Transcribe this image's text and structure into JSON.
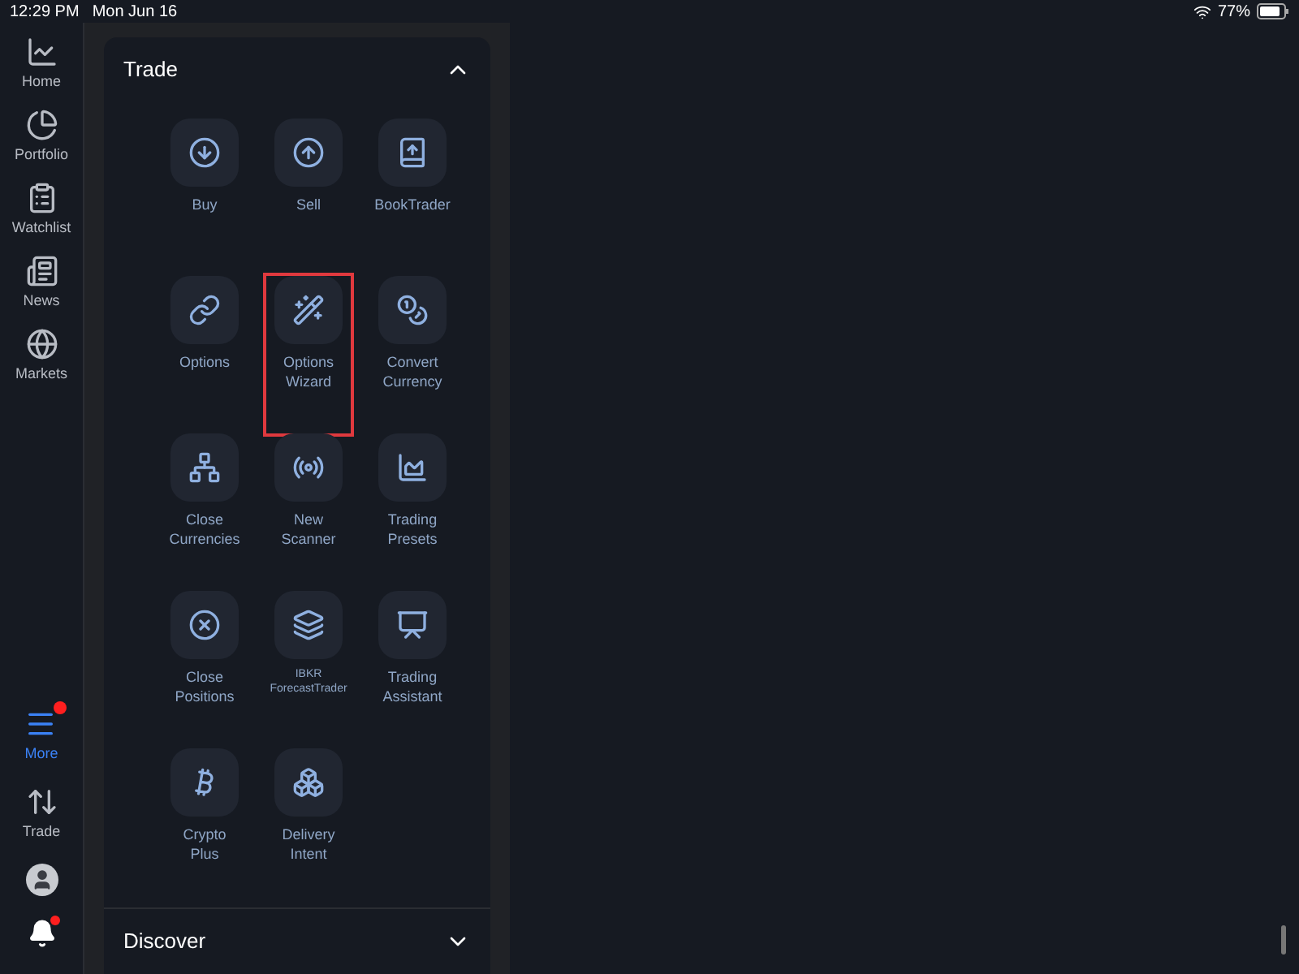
{
  "status_bar": {
    "time": "12:29 PM",
    "date": "Mon Jun 16",
    "battery": "77%"
  },
  "sidebar": {
    "items": [
      {
        "label": "Home",
        "selected": false,
        "has_alert": false
      },
      {
        "label": "Portfolio",
        "selected": false,
        "has_alert": false
      },
      {
        "label": "Watchlist",
        "selected": false,
        "has_alert": false
      },
      {
        "label": "News",
        "selected": false,
        "has_alert": false
      },
      {
        "label": "Markets",
        "selected": false,
        "has_alert": false
      }
    ],
    "bottom_items": [
      {
        "label": "More",
        "selected": true,
        "has_alert": true
      },
      {
        "label": "Trade",
        "selected": false,
        "has_alert": false
      }
    ],
    "notifications": {
      "has_alert": true
    }
  },
  "sections": [
    {
      "title": "Trade",
      "expanded": true,
      "items": [
        {
          "label": "Buy",
          "highlighted": false
        },
        {
          "label": "Sell",
          "highlighted": false
        },
        {
          "label": "BookTrader",
          "highlighted": false
        },
        {
          "label": "Options",
          "highlighted": false
        },
        {
          "label": "Options\nWizard",
          "highlighted": true
        },
        {
          "label": "Convert\nCurrency",
          "highlighted": false
        },
        {
          "label": "Close\nCurrencies",
          "highlighted": false
        },
        {
          "label": "New\nScanner",
          "highlighted": false
        },
        {
          "label": "Trading\nPresets",
          "highlighted": false
        },
        {
          "label": "Close\nPositions",
          "highlighted": false
        },
        {
          "label": "IBKR\nForecastTrader",
          "highlighted": false,
          "small": true
        },
        {
          "label": "Trading\nAssistant",
          "highlighted": false
        },
        {
          "label": "Crypto\nPlus",
          "highlighted": false
        },
        {
          "label": "Delivery\nIntent",
          "highlighted": false
        }
      ]
    },
    {
      "title": "Discover",
      "expanded": false
    }
  ]
}
